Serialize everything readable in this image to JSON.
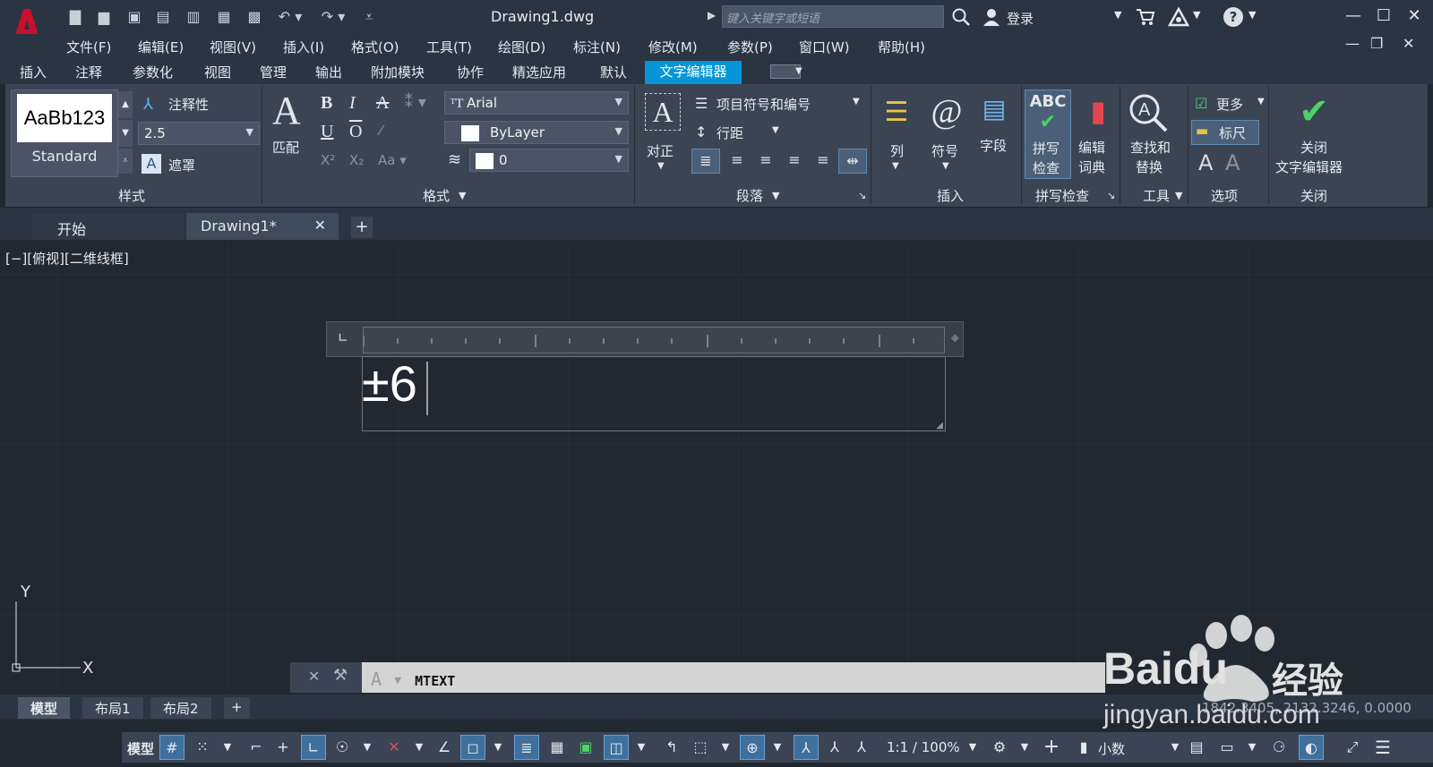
{
  "titlebar": {
    "doc_title": "Drawing1.dwg",
    "search_placeholder": "键入关键字或短语",
    "login": "登录"
  },
  "menu": [
    "文件(F)",
    "编辑(E)",
    "视图(V)",
    "插入(I)",
    "格式(O)",
    "工具(T)",
    "绘图(D)",
    "标注(N)",
    "修改(M)",
    "参数(P)",
    "窗口(W)",
    "帮助(H)"
  ],
  "ribbon_tabs": [
    "插入",
    "注释",
    "参数化",
    "视图",
    "管理",
    "输出",
    "附加模块",
    "协作",
    "精选应用",
    "默认"
  ],
  "ribbon_active_tab": "文字编辑器",
  "ribbon": {
    "style": {
      "preview": "AaBb123",
      "style_name": "Standard",
      "annotative": "注释性",
      "height": "2.5",
      "mask": "遮罩",
      "title": "样式"
    },
    "format": {
      "match": "匹配",
      "font": "Arial",
      "color": "ByLayer",
      "oblique": "0",
      "title": "格式"
    },
    "paragraph": {
      "justify": "对正",
      "bullets": "项目符号和编号",
      "line_spacing": "行距",
      "title": "段落"
    },
    "insert": {
      "columns": "列",
      "symbol": "符号",
      "field": "字段",
      "title": "插入"
    },
    "spell": {
      "check_line1": "拼写",
      "check_line2": "检查",
      "dict_line1": "编辑",
      "dict_line2": "词典",
      "title": "拼写检查"
    },
    "tools": {
      "find_line1": "查找和",
      "find_line2": "替换",
      "title": "工具"
    },
    "options": {
      "more": "更多",
      "ruler": "标尺",
      "title": "选项"
    },
    "close": {
      "line1": "关闭",
      "line2": "文字编辑器",
      "title": "关闭"
    }
  },
  "file_tabs": {
    "start": "开始",
    "drawing": "Drawing1*"
  },
  "view_label": "[−][俯视][二维线框]",
  "mtext_content": "±6",
  "ucs": {
    "y": "Y",
    "x": "X"
  },
  "command_line": "MTEXT",
  "layout_tabs": [
    "模型",
    "布局1",
    "布局2"
  ],
  "coordinates": "1842.3405, 2132.3246, 0.0000",
  "statusbar": {
    "model": "模型",
    "scale": "1:1 / 100%",
    "units": "小数"
  },
  "watermark": {
    "brand": "Baidu",
    "cn": "经验",
    "url": "jingyan.baidu.com"
  },
  "colors": {
    "accent": "#0696d7",
    "background": "#212830",
    "panel": "#3b4453",
    "logo_red": "#c8102e"
  }
}
